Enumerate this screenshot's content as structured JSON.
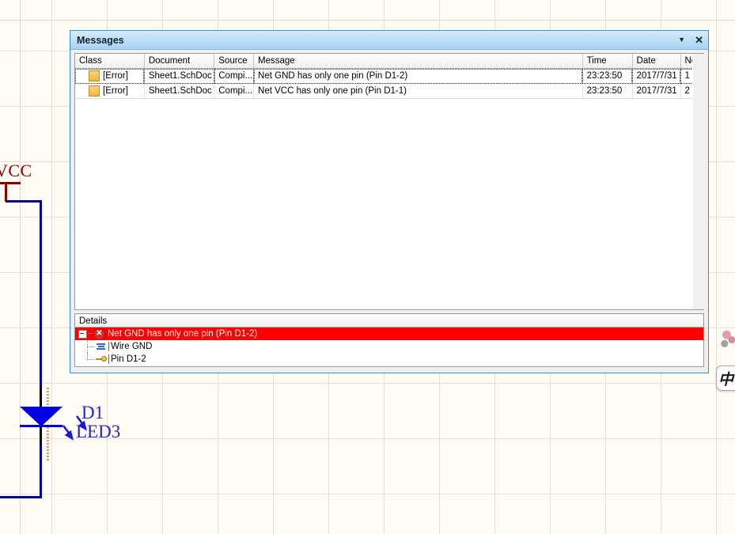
{
  "schematic": {
    "power_port_label": "VCC",
    "component_designator": "D1",
    "component_comment": "LED3"
  },
  "ime": {
    "mode_char": "中"
  },
  "panel": {
    "title": "Messages",
    "dropdown_icon": "▼",
    "close_icon": "✕",
    "columns": [
      "Class",
      "Document",
      "Source",
      "Message",
      "Time",
      "Date",
      "No."
    ],
    "rows": [
      {
        "class": "[Error]",
        "document": "Sheet1.SchDoc",
        "source": "Compi...",
        "message": "Net GND has only one pin (Pin D1-2)",
        "time": "23:23:50",
        "date": "2017/7/31",
        "no": "1"
      },
      {
        "class": "[Error]",
        "document": "Sheet1.SchDoc",
        "source": "Compi...",
        "message": "Net VCC has only one pin (Pin D1-1)",
        "time": "23:23:50",
        "date": "2017/7/31",
        "no": "2"
      }
    ],
    "details": {
      "header": "Details",
      "root_label": "Net GND has only one pin (Pin D1-2)",
      "root_icon": "✕",
      "children": [
        {
          "label": "Wire GND",
          "icon": "wire-icon"
        },
        {
          "label": "Pin D1-2",
          "icon": "pin-icon"
        }
      ]
    }
  },
  "colors": {
    "title_accent": "#a9d4f2",
    "panel_border": "#3c90d0",
    "error_highlight": "#ff0000",
    "error_swatch": "#f2b53d",
    "wire": "#00008b",
    "power_port": "#8b0000",
    "component": "#0000e0",
    "canvas": "#fdfbf4"
  }
}
